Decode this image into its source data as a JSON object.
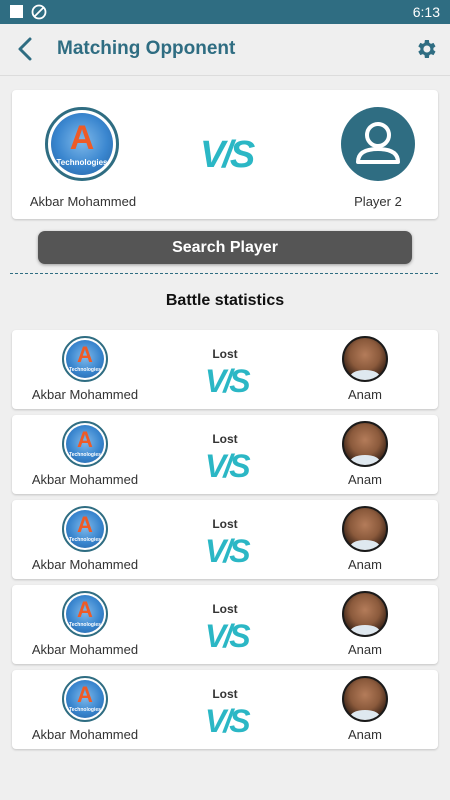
{
  "status_bar": {
    "time": "6:13"
  },
  "app_bar": {
    "title": "Matching Opponent"
  },
  "matchup": {
    "player1_name": "Akbar Mohammed",
    "player2_name": "Player 2",
    "vs_label": "V/S",
    "logo_letter": "A",
    "logo_text": "Technologies"
  },
  "search_button": {
    "label": "Search Player"
  },
  "battle_statistics": {
    "title": "Battle statistics",
    "rows": [
      {
        "result": "Lost",
        "player_name": "Akbar Mohammed",
        "opponent_name": "Anam",
        "vs_label": "V/S"
      },
      {
        "result": "Lost",
        "player_name": "Akbar Mohammed",
        "opponent_name": "Anam",
        "vs_label": "V/S"
      },
      {
        "result": "Lost",
        "player_name": "Akbar Mohammed",
        "opponent_name": "Anam",
        "vs_label": "V/S"
      },
      {
        "result": "Lost",
        "player_name": "Akbar Mohammed",
        "opponent_name": "Anam",
        "vs_label": "V/S"
      },
      {
        "result": "Lost",
        "player_name": "Akbar Mohammed",
        "opponent_name": "Anam",
        "vs_label": "V/S"
      }
    ]
  },
  "colors": {
    "primary": "#2f6d82",
    "accent": "#2bb7c5",
    "button": "#555555",
    "logo_orange": "#ee5b27"
  }
}
